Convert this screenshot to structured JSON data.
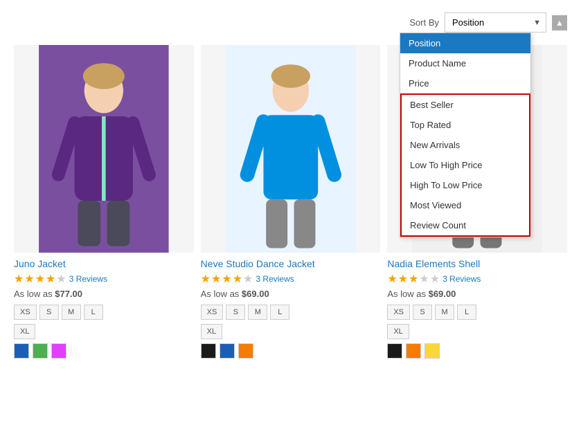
{
  "sortBar": {
    "label": "Sort By",
    "currentValue": "Position",
    "upArrow": "▲"
  },
  "dropdown": {
    "items": [
      {
        "id": "position",
        "label": "Position",
        "active": true,
        "highlighted": false
      },
      {
        "id": "product-name",
        "label": "Product Name",
        "active": false,
        "highlighted": false
      },
      {
        "id": "price",
        "label": "Price",
        "active": false,
        "highlighted": false
      },
      {
        "id": "best-seller",
        "label": "Best Seller",
        "active": false,
        "highlighted": true
      },
      {
        "id": "top-rated",
        "label": "Top Rated",
        "active": false,
        "highlighted": true
      },
      {
        "id": "new-arrivals",
        "label": "New Arrivals",
        "active": false,
        "highlighted": true
      },
      {
        "id": "low-to-high",
        "label": "Low To High Price",
        "active": false,
        "highlighted": true
      },
      {
        "id": "high-to-low",
        "label": "High To Low Price",
        "active": false,
        "highlighted": true
      },
      {
        "id": "most-viewed",
        "label": "Most Viewed",
        "active": false,
        "highlighted": true
      },
      {
        "id": "review-count",
        "label": "Review Count",
        "active": false,
        "highlighted": true
      }
    ]
  },
  "products": [
    {
      "id": "juno",
      "name": "Juno Jacket",
      "stars": [
        1,
        1,
        1,
        1,
        0
      ],
      "reviewCount": "3 Reviews",
      "priceLabel": "As low as",
      "price": "$77.00",
      "sizes": [
        "XS",
        "S",
        "M",
        "L",
        "XL"
      ],
      "colors": [
        "#1a5fb4",
        "#4caf50",
        "#e040fb"
      ]
    },
    {
      "id": "neve",
      "name": "Neve Studio Dance Jacket",
      "stars": [
        1,
        1,
        1,
        1,
        0
      ],
      "reviewCount": "3 Reviews",
      "priceLabel": "As low as",
      "price": "$69.00",
      "sizes": [
        "XS",
        "S",
        "M",
        "L",
        "XL"
      ],
      "colors": [
        "#1a1a1a",
        "#1a5fb4",
        "#f57c00"
      ]
    },
    {
      "id": "nadia",
      "name": "Nadia Elements Shell",
      "stars": [
        1,
        1,
        1,
        0,
        0
      ],
      "reviewCount": "3 Reviews",
      "priceLabel": "As low as",
      "price": "$69.00",
      "sizes": [
        "XS",
        "S",
        "M",
        "L",
        "XL"
      ],
      "colors": [
        "#1a1a1a",
        "#f57c00",
        "#fdd835"
      ]
    }
  ]
}
